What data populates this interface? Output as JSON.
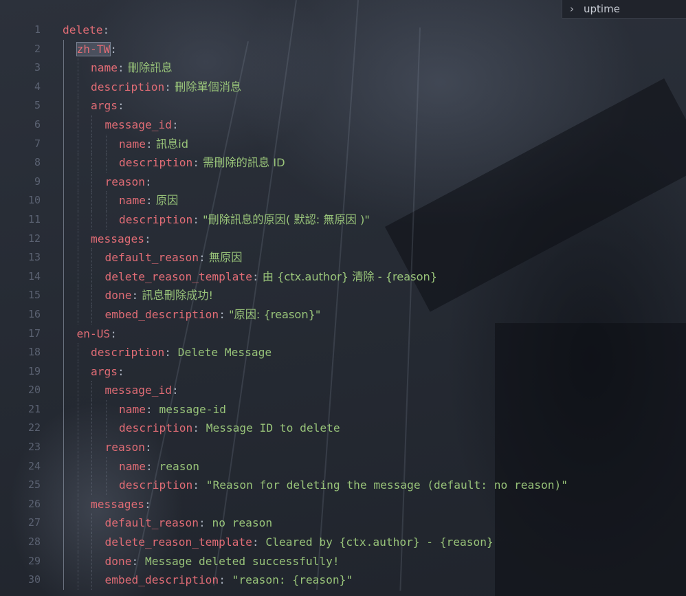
{
  "panel": {
    "label": "uptime"
  },
  "lines": [
    {
      "n": "1",
      "indent": 0,
      "key": "delete",
      "value": ""
    },
    {
      "n": "2",
      "indent": 1,
      "key": "zh-TW",
      "value": "",
      "selected": true
    },
    {
      "n": "3",
      "indent": 2,
      "key": "name",
      "value": "刪除訊息"
    },
    {
      "n": "4",
      "indent": 2,
      "key": "description",
      "value": "刪除單個消息"
    },
    {
      "n": "5",
      "indent": 2,
      "key": "args",
      "value": ""
    },
    {
      "n": "6",
      "indent": 3,
      "key": "message_id",
      "value": ""
    },
    {
      "n": "7",
      "indent": 4,
      "key": "name",
      "value": "訊息id"
    },
    {
      "n": "8",
      "indent": 4,
      "key": "description",
      "value": "需刪除的訊息 ID"
    },
    {
      "n": "9",
      "indent": 3,
      "key": "reason",
      "value": ""
    },
    {
      "n": "10",
      "indent": 4,
      "key": "name",
      "value": "原因"
    },
    {
      "n": "11",
      "indent": 4,
      "key": "description",
      "value": "\"刪除訊息的原因( 默認: 無原因 )\""
    },
    {
      "n": "12",
      "indent": 2,
      "key": "messages",
      "value": ""
    },
    {
      "n": "13",
      "indent": 3,
      "key": "default_reason",
      "value": "無原因"
    },
    {
      "n": "14",
      "indent": 3,
      "key": "delete_reason_template",
      "value": "由 {ctx.author} 清除 - {reason}"
    },
    {
      "n": "15",
      "indent": 3,
      "key": "done",
      "value": "訊息刪除成功!"
    },
    {
      "n": "16",
      "indent": 3,
      "key": "embed_description",
      "value": "\"原因: {reason}\""
    },
    {
      "n": "17",
      "indent": 1,
      "key": "en-US",
      "value": ""
    },
    {
      "n": "18",
      "indent": 2,
      "key": "description",
      "value": "Delete Message"
    },
    {
      "n": "19",
      "indent": 2,
      "key": "args",
      "value": ""
    },
    {
      "n": "20",
      "indent": 3,
      "key": "message_id",
      "value": ""
    },
    {
      "n": "21",
      "indent": 4,
      "key": "name",
      "value": "message-id"
    },
    {
      "n": "22",
      "indent": 4,
      "key": "description",
      "value": "Message ID to delete"
    },
    {
      "n": "23",
      "indent": 3,
      "key": "reason",
      "value": ""
    },
    {
      "n": "24",
      "indent": 4,
      "key": "name",
      "value": "reason"
    },
    {
      "n": "25",
      "indent": 4,
      "key": "description",
      "value": "\"Reason for deleting the message (default: no reason)\""
    },
    {
      "n": "26",
      "indent": 2,
      "key": "messages",
      "value": ""
    },
    {
      "n": "27",
      "indent": 3,
      "key": "default_reason",
      "value": "no reason"
    },
    {
      "n": "28",
      "indent": 3,
      "key": "delete_reason_template",
      "value": "Cleared by {ctx.author} - {reason}"
    },
    {
      "n": "29",
      "indent": 3,
      "key": "done",
      "value": "Message deleted successfully!"
    },
    {
      "n": "30",
      "indent": 3,
      "key": "embed_description",
      "value": "\"reason: {reason}\""
    }
  ],
  "colors": {
    "key": "#e06c75",
    "value": "#98c379",
    "line_number": "#5b6272",
    "background": "#262b34"
  }
}
